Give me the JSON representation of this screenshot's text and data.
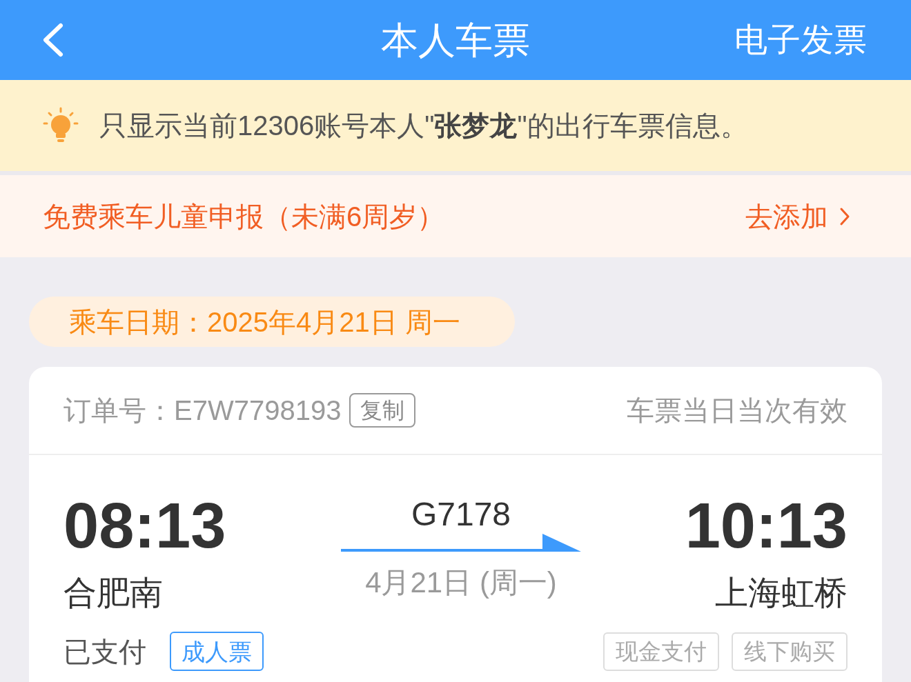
{
  "header": {
    "title": "本人车票",
    "action": "电子发票"
  },
  "notice": {
    "text": "只显示当前12306账号本人\"**张梦龙**\"的出行车票信息。"
  },
  "child_banner": {
    "text": "免费乘车儿童申报（未满6周岁）",
    "action": "去添加"
  },
  "travel_date": "乘车日期：2025年4月21日 周一",
  "ticket": {
    "order_number": "订单号：E7W7798193",
    "copy_button": "复制",
    "validity": "车票当日当次有效",
    "departure": {
      "time": "08:13",
      "station": "合肥南"
    },
    "train_number": "G7178",
    "date": "4月21日 (周一)",
    "arrival": {
      "time": "10:13",
      "station": "上海虹桥"
    },
    "payment_status": "已支付",
    "ticket_type": "成人票",
    "labels": [
      "现金支付",
      "线下购买"
    ]
  }
}
